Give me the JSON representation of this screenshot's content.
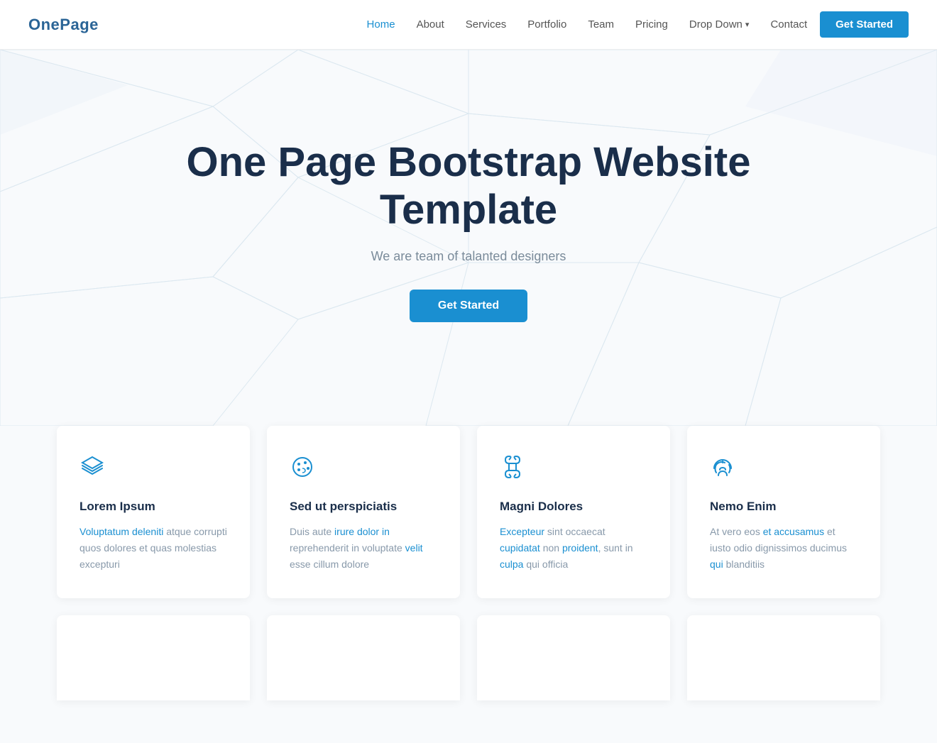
{
  "brand": {
    "logo": "OnePage"
  },
  "nav": {
    "links": [
      {
        "label": "Home",
        "active": true,
        "id": "home"
      },
      {
        "label": "About",
        "active": false,
        "id": "about"
      },
      {
        "label": "Services",
        "active": false,
        "id": "services"
      },
      {
        "label": "Portfolio",
        "active": false,
        "id": "portfolio"
      },
      {
        "label": "Team",
        "active": false,
        "id": "team"
      },
      {
        "label": "Pricing",
        "active": false,
        "id": "pricing"
      },
      {
        "label": "Drop Down",
        "active": false,
        "id": "dropdown",
        "hasChevron": true
      },
      {
        "label": "Contact",
        "active": false,
        "id": "contact"
      }
    ],
    "cta_label": "Get Started"
  },
  "hero": {
    "title": "One Page Bootstrap Website Template",
    "subtitle": "We are team of talanted designers",
    "cta_label": "Get Started"
  },
  "cards": [
    {
      "icon": "layers",
      "title": "Lorem Ipsum",
      "text": "Voluptatum deleniti atque corrupti quos dolores et quas molestias excepturi"
    },
    {
      "icon": "palette",
      "title": "Sed ut perspiciatis",
      "text": "Duis aute irure dolor in reprehenderit in voluptate velit esse cillum dolore"
    },
    {
      "icon": "command",
      "title": "Magni Dolores",
      "text": "Excepteur sint occaecat cupidatat non proident, sunt in culpa qui officia"
    },
    {
      "icon": "fingerprint",
      "title": "Nemo Enim",
      "text": "At vero eos et accusamus et iusto odio dignissimos ducimus qui blanditiis"
    }
  ],
  "colors": {
    "primary": "#1a8fd1",
    "dark": "#1a2e4a",
    "text_muted": "#8899aa",
    "bg_light": "#f8fafc"
  }
}
